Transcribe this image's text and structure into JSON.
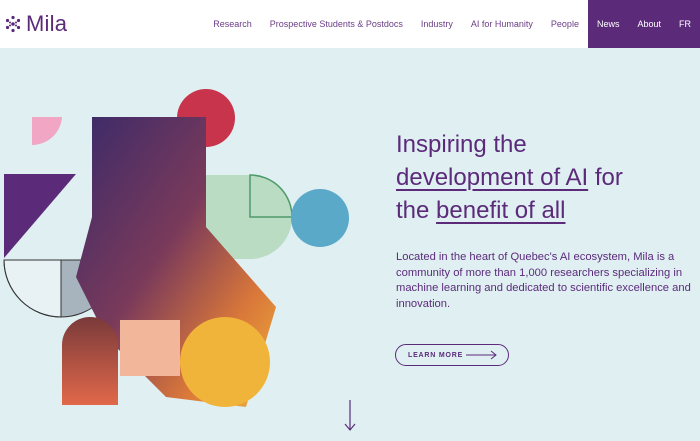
{
  "brand": {
    "name": "Mila",
    "color": "#5b2b7a"
  },
  "nav": {
    "items": [
      {
        "label": "Research"
      },
      {
        "label": "Prospective Students & Postdocs"
      },
      {
        "label": "Industry"
      },
      {
        "label": "AI for Humanity"
      },
      {
        "label": "People"
      },
      {
        "label": "News"
      },
      {
        "label": "About"
      },
      {
        "label": "FR"
      }
    ]
  },
  "hero": {
    "headline_part1": "Inspiring the",
    "headline_link1": "development of AI",
    "headline_part2": "for",
    "headline_part3": "the",
    "headline_link2": "benefit of all",
    "description": "Located in the heart of Quebec's AI ecosystem, Mila is a community of more than 1,000 researchers specializing in machine learning and dedicated to scientific excellence and innovation.",
    "cta_label": "LEARN MORE"
  },
  "icons": {
    "cta_arrow": "arrow-right-icon",
    "scroll": "arrow-down-icon"
  },
  "colors": {
    "background": "#dfeff2",
    "accent": "#5b2b7a"
  }
}
